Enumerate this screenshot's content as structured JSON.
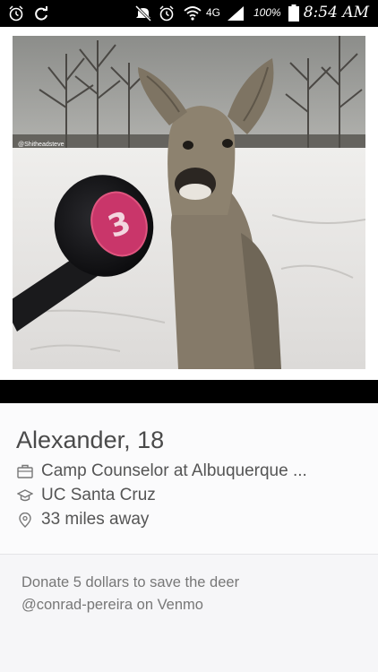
{
  "status_bar": {
    "network": "4G",
    "battery": "100%",
    "time": "8:54 AM"
  },
  "photo": {
    "watermark": "@Shitheadsteve",
    "microphone_logo": "3"
  },
  "profile": {
    "name_age": "Alexander, 18",
    "job": "Camp Counselor at Albuquerque ...",
    "school": "UC Santa Cruz",
    "distance": "33 miles away"
  },
  "bio": {
    "line1": "Donate 5 dollars to save the deer",
    "line2": "@conrad-pereira on Venmo"
  },
  "icons": {
    "job": "briefcase-icon",
    "school": "graduation-cap-icon",
    "distance": "location-pin-icon"
  }
}
